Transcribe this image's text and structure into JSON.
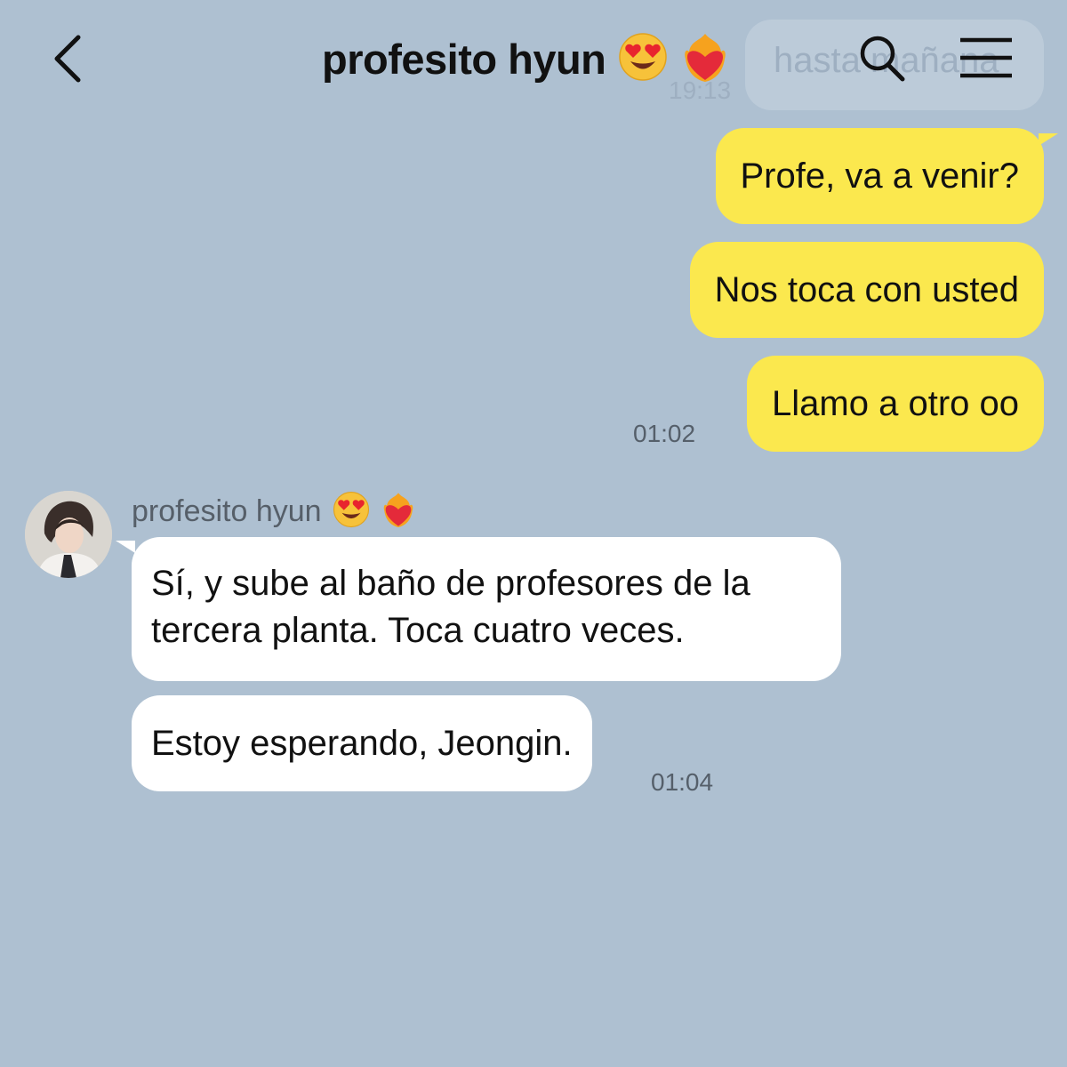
{
  "header": {
    "title": "profesito hyun",
    "back_icon": "chevron-left-icon",
    "search_icon": "search-icon",
    "menu_icon": "hamburger-menu-icon",
    "title_emojis": [
      "smiling-face-with-heart-eyes-emoji",
      "heart-on-fire-emoji"
    ]
  },
  "background_message": {
    "text": "hasta mañana",
    "time": "19:13"
  },
  "messages": [
    {
      "direction": "outgoing",
      "text": "Profe, va a venir?"
    },
    {
      "direction": "outgoing",
      "text": "Nos toca con usted"
    },
    {
      "direction": "outgoing",
      "text": "Llamo a otro oo",
      "time": "01:02"
    },
    {
      "direction": "incoming",
      "lines": [
        "Sí, y sube al baño de profesores de la",
        "tercera planta. Toca cuatro veces."
      ]
    },
    {
      "direction": "incoming",
      "text": "Estoy esperando, Jeongin.",
      "time": "01:04"
    }
  ],
  "sender": {
    "name": "profesito hyun",
    "avatar": "profile-photo"
  },
  "colors": {
    "background": "#aec0d1",
    "outgoing_bubble": "#fbe84e",
    "incoming_bubble": "#ffffff",
    "timestamp": "#555f6a"
  }
}
